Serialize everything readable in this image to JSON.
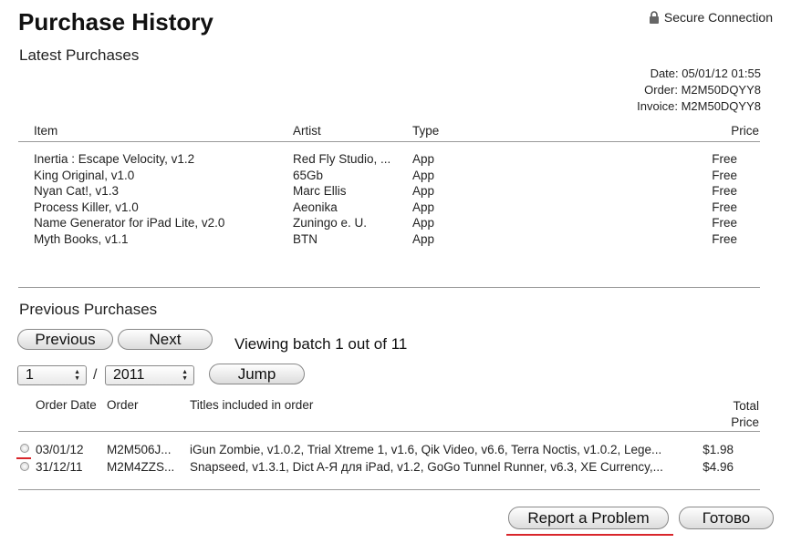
{
  "header": {
    "title": "Purchase History",
    "secure_label": "Secure Connection"
  },
  "latest": {
    "heading": "Latest Purchases",
    "date": "Date: 05/01/12 01:55",
    "order": "Order: M2M50DQYY8",
    "invoice": "Invoice: M2M50DQYY8",
    "columns": {
      "item": "Item",
      "artist": "Artist",
      "type": "Type",
      "price": "Price"
    },
    "rows": [
      {
        "item": "Inertia : Escape Velocity, v1.2",
        "artist": "Red Fly Studio, ...",
        "type": "App",
        "price": "Free"
      },
      {
        "item": "King Original, v1.0",
        "artist": "65Gb",
        "type": "App",
        "price": "Free"
      },
      {
        "item": "Nyan Cat!, v1.3",
        "artist": "Marc Ellis",
        "type": "App",
        "price": "Free"
      },
      {
        "item": "Process Killer, v1.0",
        "artist": "Aeonika",
        "type": "App",
        "price": "Free"
      },
      {
        "item": "Name Generator for iPad Lite, v2.0",
        "artist": "Zuningo e. U.",
        "type": "App",
        "price": "Free"
      },
      {
        "item": "Myth Books, v1.1",
        "artist": "BTN",
        "type": "App",
        "price": "Free"
      }
    ]
  },
  "previous": {
    "heading": "Previous Purchases",
    "prev_label": "Previous",
    "next_label": "Next",
    "batch_text": "Viewing batch 1 out of 11",
    "month_value": "1",
    "separator": "/",
    "year_value": "2011",
    "jump_label": "Jump",
    "columns": {
      "order_date": "Order Date",
      "order": "Order",
      "titles": "Titles included in order",
      "total_line1": "Total",
      "total_line2": "Price"
    },
    "rows": [
      {
        "date": "03/01/12",
        "order": "M2M506J...",
        "titles": "iGun Zombie, v1.0.2, Trial Xtreme 1, v1.6, Qik Video, v6.6, Terra Noctis, v1.0.2, Lege...",
        "total": "$1.98"
      },
      {
        "date": "31/12/11",
        "order": "M2M4ZZS...",
        "titles": "Snapseed, v1.3.1, Dict A-Я для iPad, v1.2, GoGo Tunnel Runner, v6.3, XE Currency,...",
        "total": "$4.96"
      }
    ]
  },
  "footer": {
    "report_label": "Report a Problem",
    "done_label": "Готово"
  },
  "colors": {
    "highlight": "#d9262b"
  },
  "icons": [
    "lock-icon",
    "radio-icon",
    "select-arrows-icon"
  ]
}
